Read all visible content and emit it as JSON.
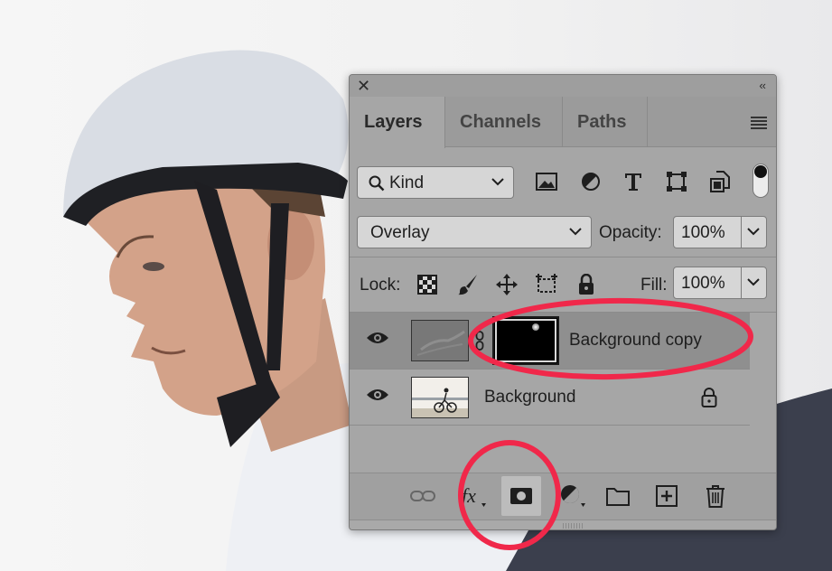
{
  "panel": {
    "tabs": [
      {
        "label": "Layers"
      },
      {
        "label": "Channels"
      },
      {
        "label": "Paths"
      }
    ],
    "filter": {
      "kind_label": "Kind"
    },
    "blend_mode": "Overlay",
    "opacity": {
      "label": "Opacity:",
      "value": "100%"
    },
    "lock": {
      "label": "Lock:"
    },
    "fill": {
      "label": "Fill:",
      "value": "100%"
    },
    "layers": [
      {
        "name": "Background copy",
        "selected": true
      },
      {
        "name": "Background",
        "locked": true
      }
    ]
  },
  "icons": {
    "filters": [
      "image-filter-icon",
      "adjustment-filter-icon",
      "type-filter-icon",
      "shape-filter-icon",
      "smart-object-filter-icon"
    ],
    "lock": [
      "lock-transparent-pixels-icon",
      "lock-image-pixels-icon",
      "lock-position-icon",
      "lock-artboard-icon",
      "lock-all-icon"
    ],
    "footer": [
      "link-layers-icon",
      "fx-icon",
      "add-layer-mask-icon",
      "adjustment-layer-icon",
      "group-folder-icon",
      "new-layer-icon",
      "trash-icon"
    ]
  },
  "colors": {
    "annotation": "#f0284a",
    "panel": "#a6a6a6",
    "selected_row": "#8f8f8f"
  }
}
